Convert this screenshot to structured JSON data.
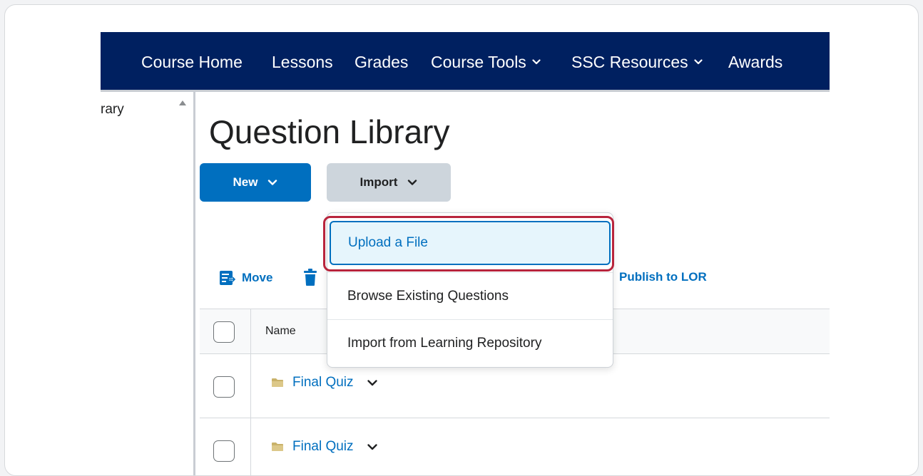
{
  "nav": {
    "items": [
      {
        "label": "Course Home",
        "dropdown": false
      },
      {
        "label": "Lessons",
        "dropdown": false
      },
      {
        "label": "Grades",
        "dropdown": false
      },
      {
        "label": "Course Tools",
        "dropdown": true
      },
      {
        "label": "SSC Resources",
        "dropdown": true
      },
      {
        "label": "Awards",
        "dropdown": false
      }
    ]
  },
  "left_panel": {
    "partial_text": "rary"
  },
  "page": {
    "title": "Question Library"
  },
  "buttons": {
    "new_label": "New",
    "import_label": "Import"
  },
  "toolbar": {
    "move_label": "Move",
    "publish_label": "Publish to LOR"
  },
  "table": {
    "header_name": "Name",
    "rows": [
      {
        "name": "Final Quiz"
      },
      {
        "name": "Final Quiz"
      }
    ]
  },
  "import_menu": {
    "items": [
      {
        "label": "Upload a File",
        "highlighted": true
      },
      {
        "label": "Browse Existing Questions",
        "highlighted": false
      },
      {
        "label": "Import from Learning Repository",
        "highlighted": false
      }
    ]
  },
  "colors": {
    "navbar_bg": "#002060",
    "primary": "#006fbf",
    "import_bg": "#cdd5dc",
    "highlight_border": "#b8243c",
    "menu_active_bg": "#e6f5fc",
    "folder": "#c9b26a"
  }
}
